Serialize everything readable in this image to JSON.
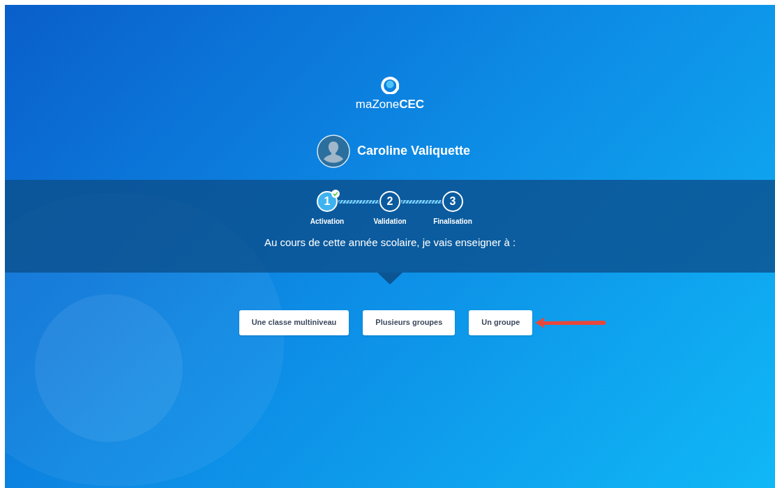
{
  "logo": {
    "text": "maZone**CEC**"
  },
  "user": {
    "name": "Caroline Valiquette"
  },
  "steps": [
    {
      "number": "1",
      "label": "Activation",
      "completed": true
    },
    {
      "number": "2",
      "label": "Validation",
      "completed": false
    },
    {
      "number": "3",
      "label": "Finalisation",
      "completed": false
    }
  ],
  "prompt": "Au cours de cette année scolaire, je vais enseigner à :",
  "options": [
    {
      "label": "Une classe multiniveau",
      "highlighted": false
    },
    {
      "label": "Plusieurs groupes",
      "highlighted": false
    },
    {
      "label": "Un groupe",
      "highlighted": true
    }
  ]
}
